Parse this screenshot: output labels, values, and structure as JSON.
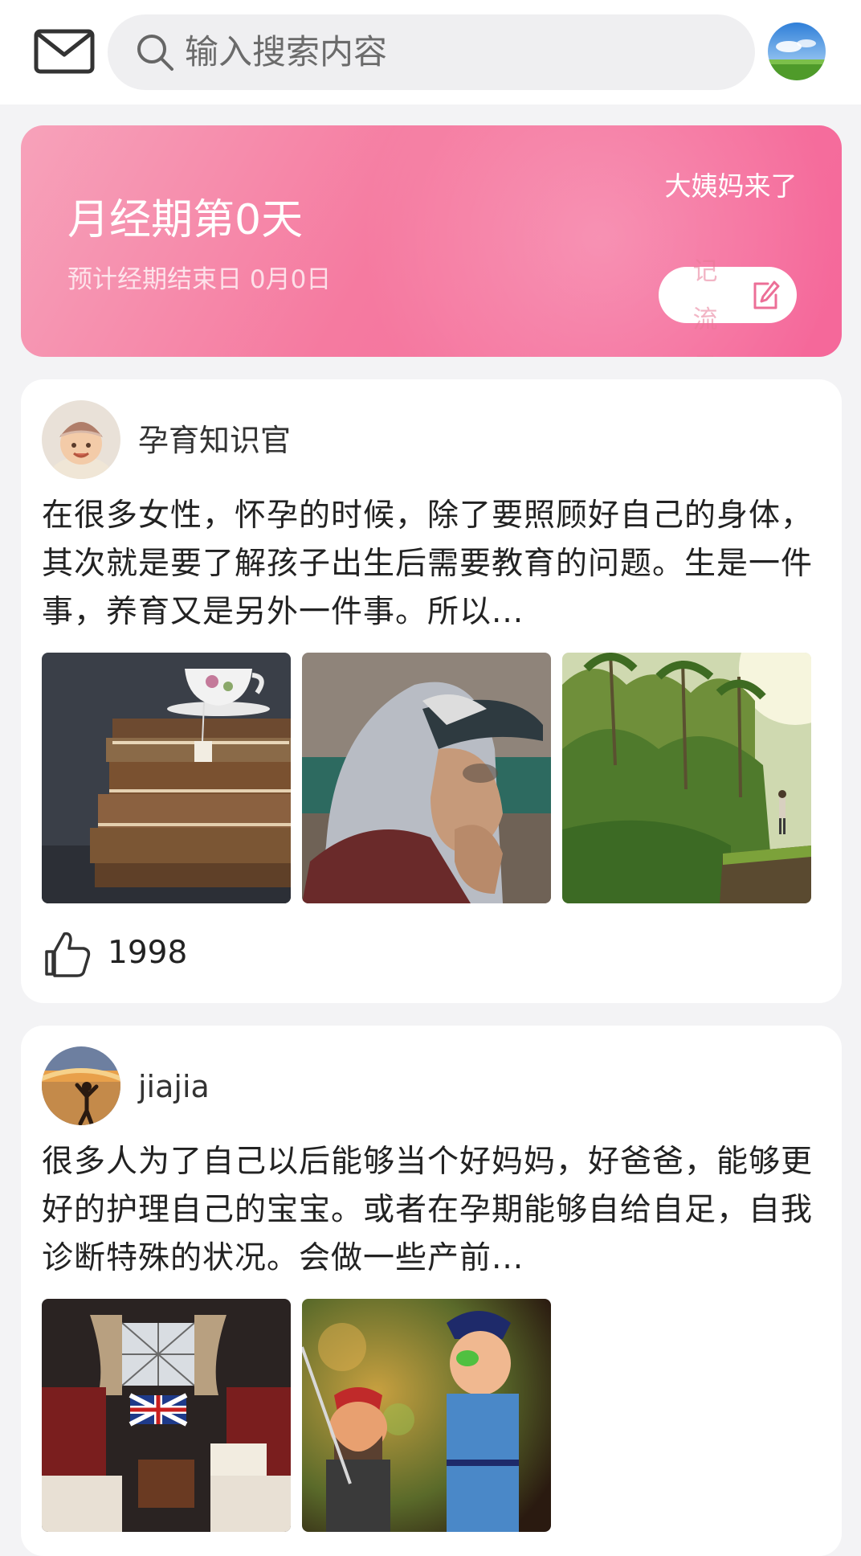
{
  "header": {
    "search_placeholder": "输入搜索内容",
    "mail_icon": "mail-icon",
    "search_icon": "search-icon"
  },
  "banner": {
    "title": "月经期第0天",
    "subtitle": "预计经期结束日 0月0日",
    "prompt": "大姨妈来了",
    "record_button_label": "记流量",
    "edit_icon": "edit-icon",
    "colors": {
      "from": "#f7a2ba",
      "to": "#f5679a"
    }
  },
  "posts": [
    {
      "author": "孕育知识官",
      "text": "在很多女性，怀孕的时候，除了要照顾好自己的身体，其次就是要了解孩子出生后需要教育的问题。生是一件事，养育又是另外一件事。所以...",
      "likes": "1998",
      "photos": [
        "stacked-books-teacup",
        "elderly-woman-hood-cap",
        "jungle-rice-terrace"
      ]
    },
    {
      "author": "jiajia",
      "text": "很多人为了自己以后能够当个好妈妈，好爸爸，能够更好的护理自己的宝宝。或者在孕期能够自给自足，自我诊断特殊的状况。会做一些产前...",
      "photos": [
        "train-cabin-union-jack",
        "pirate-police-figurines"
      ]
    }
  ]
}
